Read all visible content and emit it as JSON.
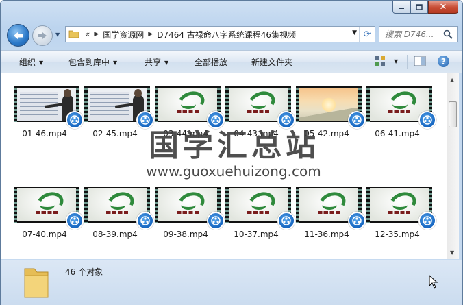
{
  "window": {
    "caption_buttons": [
      "minimize",
      "maximize",
      "close"
    ]
  },
  "nav": {
    "back_icon": "arrow-left-icon",
    "forward_icon": "arrow-right-icon",
    "recent_icon": "chevron-down-icon"
  },
  "address": {
    "overflow": "«",
    "breadcrumbs": [
      "国学资源网",
      "D7464 古禄命八字系统课程46集视频"
    ]
  },
  "search": {
    "placeholder": "搜索 D746..."
  },
  "toolbar": {
    "organize": "组织",
    "include_library": "包含到库中",
    "share": "共享",
    "play_all": "全部播放",
    "new_folder": "新建文件夹"
  },
  "files": [
    {
      "name": "01-46.mp4",
      "thumb": "lecture"
    },
    {
      "name": "02-45.mp4",
      "thumb": "lecture"
    },
    {
      "name": "03-44.mp4",
      "thumb": "logo"
    },
    {
      "name": "04-43.mp4",
      "thumb": "logo"
    },
    {
      "name": "05-42.mp4",
      "thumb": "sunrise"
    },
    {
      "name": "06-41.mp4",
      "thumb": "logo"
    },
    {
      "name": "07-40.mp4",
      "thumb": "logo"
    },
    {
      "name": "08-39.mp4",
      "thumb": "logo"
    },
    {
      "name": "09-38.mp4",
      "thumb": "logo"
    },
    {
      "name": "10-37.mp4",
      "thumb": "logo"
    },
    {
      "name": "11-36.mp4",
      "thumb": "logo"
    },
    {
      "name": "12-35.mp4",
      "thumb": "logo"
    }
  ],
  "watermark": {
    "title": "国学汇总站",
    "url": "www.guoxuehuizong.com"
  },
  "details": {
    "count": "46 个对象"
  },
  "colors": {
    "chrome": "#c6daf0",
    "close_button": "#c74b33",
    "media_badge": "#1565c0"
  }
}
